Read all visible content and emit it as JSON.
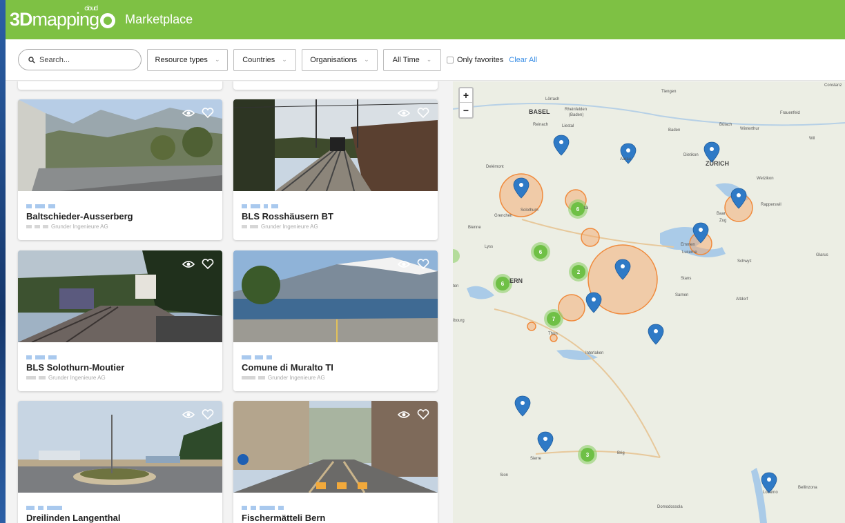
{
  "header": {
    "logo_main": "3D",
    "logo_mapping": "mapping",
    "logo_cloud": "cloud",
    "title": "Marketplace",
    "color": "#7ec144"
  },
  "filters": {
    "search_placeholder": "Search...",
    "resource_types": "Resource types",
    "countries": "Countries",
    "organisations": "Organisations",
    "time": "All Time",
    "only_favorites": "Only favorites",
    "clear_all": "Clear All",
    "link_color": "#3a8ee6"
  },
  "cards": [
    {
      "title": "Baltschieder-Ausserberg",
      "org": "Grunder Ingenieure AG"
    },
    {
      "title": "BLS Rosshäusern BT",
      "org": "Grunder Ingenieure AG"
    },
    {
      "title": "BLS Solothurn-Moutier",
      "org": "Grunder Ingenieure AG"
    },
    {
      "title": "Comune di Muralto TI",
      "org": "Grunder Ingenieure AG"
    },
    {
      "title": "Dreilinden Langenthal",
      "org": ""
    },
    {
      "title": "Fischermätteli Bern",
      "org": ""
    }
  ],
  "map": {
    "zoom_in": "+",
    "zoom_out": "−",
    "labels": {
      "tiengen": "Tiengen",
      "constance": "Constanz",
      "lorrach": "Lörrach",
      "basel": "BASEL",
      "rheinfelden": "Rheinfelden",
      "baden_paren": "(Baden)",
      "frauenfeld": "Frauenfeld",
      "reinach": "Reinach",
      "liestal": "Liestal",
      "baden": "Baden",
      "bulach": "Bülach",
      "winterthur": "Winterthur",
      "wil": "Wil",
      "delemont": "Delémont",
      "aarau": "Aarau",
      "dietikon": "Dietikon",
      "zurich": "ZÜRICH",
      "wetzikon": "Wetzikon",
      "solothurn": "Solothurn",
      "grenchen": "Grenchen",
      "rapperswil": "Rapperswil",
      "baar": "Baar",
      "zug": "Zug",
      "bienne": "Bienne",
      "lyss": "Lyss",
      "emmen": "Emmen",
      "lucerne": "Lucerne",
      "glarus": "Glarus",
      "schwyz": "Schwyz",
      "bern": "ERN",
      "stans": "Stans",
      "sarnen": "Sarnen",
      "altdorf": "Altdorf",
      "ten": "ten",
      "fribourg": "ibourg",
      "thun": "Thun",
      "interlaken": "Interlaken",
      "sierre": "Sierre",
      "brig": "Brig",
      "sion": "Sion",
      "bellinzona": "Bellinzona",
      "locarno": "Locarno",
      "domodossola": "Domodossola",
      "tal": "tal",
      "fen": "en",
      "lp": "p"
    },
    "clusters": {
      "c6a": "6",
      "c6b": "6",
      "c6c": "6",
      "c2": "2",
      "c7": "7",
      "c3": "3"
    },
    "colors": {
      "pin": "#2f7ac6",
      "cluster": "#8fd16a",
      "area": "#f4a86b",
      "lake": "#aacbe8"
    }
  }
}
